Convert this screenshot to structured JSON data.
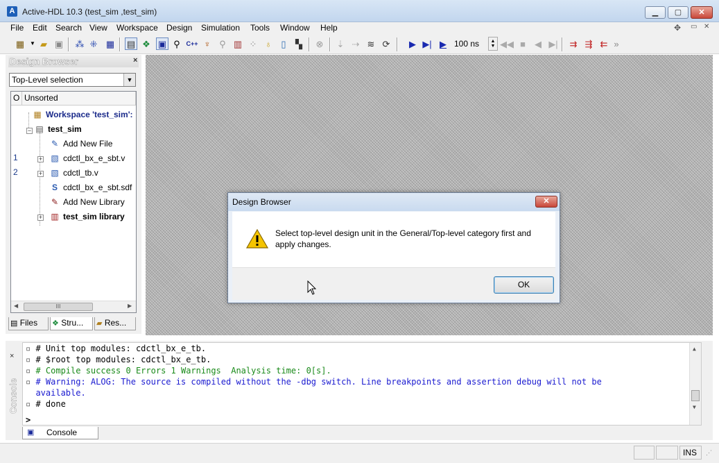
{
  "window": {
    "title": "Active-HDL 10.3 (test_sim ,test_sim)",
    "app_icon_letter": "A",
    "minimize": "▁",
    "maximize": "▢",
    "close": "✕"
  },
  "menu": {
    "items": [
      "File",
      "Edit",
      "Search",
      "View",
      "Workspace",
      "Design",
      "Simulation",
      "Tools",
      "Window",
      "Help"
    ],
    "right_glyphs": [
      "✥",
      "▭",
      "✕"
    ]
  },
  "toolbar": {
    "sim_time": "100 ns",
    "more": "»"
  },
  "design_browser": {
    "title": "Design Browser",
    "close": "×",
    "selector_value": "Top-Level selection",
    "columns": [
      "O",
      "Unsorted"
    ],
    "rows": [
      {
        "num": "",
        "label": "Workspace 'test_sim':",
        "bold": true
      },
      {
        "num": "",
        "label": "test_sim",
        "bold": true
      },
      {
        "num": "",
        "label": "Add New File",
        "bold": false
      },
      {
        "num": "1",
        "label": "cdctl_bx_e_sbt.v",
        "bold": false
      },
      {
        "num": "2",
        "label": "cdctl_tb.v",
        "bold": false
      },
      {
        "num": "",
        "label": "cdctl_bx_e_sbt.sdf",
        "bold": false
      },
      {
        "num": "",
        "label": "Add New Library",
        "bold": false
      },
      {
        "num": "",
        "label": "test_sim library",
        "bold": true
      }
    ],
    "scroll_thumb": "III",
    "tabs": [
      "Files",
      "Stru...",
      "Res..."
    ]
  },
  "dialog": {
    "title": "Design Browser",
    "close": "✕",
    "message": "Select top-level design unit in the General/Top-level category first and apply changes.",
    "ok_label": "OK"
  },
  "console": {
    "side_label": "Console",
    "close": "×",
    "lines": [
      {
        "text": "# Unit top modules: cdctl_bx_e_tb.",
        "color": "#000000"
      },
      {
        "text": "# $root top modules: cdctl_bx_e_tb.",
        "color": "#000000"
      },
      {
        "text": "# Compile success 0 Errors 1 Warnings  Analysis time: 0[s].",
        "color": "#1a8a1a"
      },
      {
        "text": "# Warning: ALOG: The source is compiled without the -dbg switch. Line breakpoints and assertion debug will not be",
        "color": "#1a1ad0"
      },
      {
        "text": "available.",
        "color": "#1a1ad0"
      },
      {
        "text": "# done",
        "color": "#000000"
      }
    ],
    "prompt": ">",
    "tab_label": "Console"
  },
  "status": {
    "mode": "INS"
  },
  "colors": {
    "warning_green": "#1a8a1a",
    "warning_blue": "#1a1ad0"
  }
}
